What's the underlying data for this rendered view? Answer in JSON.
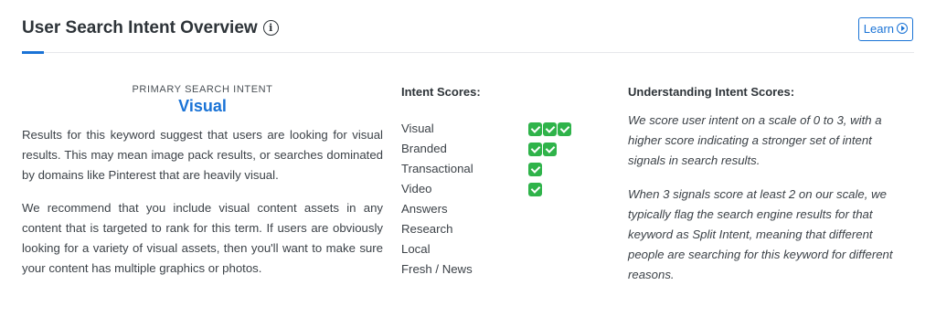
{
  "header": {
    "title": "User Search Intent Overview",
    "info_glyph": "i",
    "learn_label": "Learn"
  },
  "primary": {
    "label": "PRIMARY SEARCH INTENT",
    "value": "Visual"
  },
  "left": {
    "paragraph1": "Results for this keyword suggest that users are looking for visual results. This may mean image pack results, or searches dominated by domains like Pinterest that are heavily visual.",
    "paragraph2": "We recommend that you include visual content assets in any content that is targeted to rank for this term. If users are obviously looking for a variety of visual assets, then you'll want to make sure your content has multiple graphics or photos."
  },
  "scores": {
    "heading": "Intent Scores:",
    "items": [
      {
        "name": "Visual",
        "score": 3
      },
      {
        "name": "Branded",
        "score": 2
      },
      {
        "name": "Transactional",
        "score": 1
      },
      {
        "name": "Video",
        "score": 1
      },
      {
        "name": "Answers",
        "score": 0
      },
      {
        "name": "Research",
        "score": 0
      },
      {
        "name": "Local",
        "score": 0
      },
      {
        "name": "Fresh / News",
        "score": 0
      }
    ]
  },
  "understanding": {
    "heading": "Understanding Intent Scores:",
    "paragraph1": "We score user intent on a scale of 0 to 3, with a higher score indicating a stronger set of intent signals in search results.",
    "paragraph2": "When 3 signals score at least 2 on our scale, we typically flag the search engine results for that keyword as Split Intent, meaning that different people are searching for this keyword for different reasons."
  },
  "colors": {
    "accent": "#1a73d6",
    "check": "#2fb34a",
    "text": "#3c4248"
  }
}
